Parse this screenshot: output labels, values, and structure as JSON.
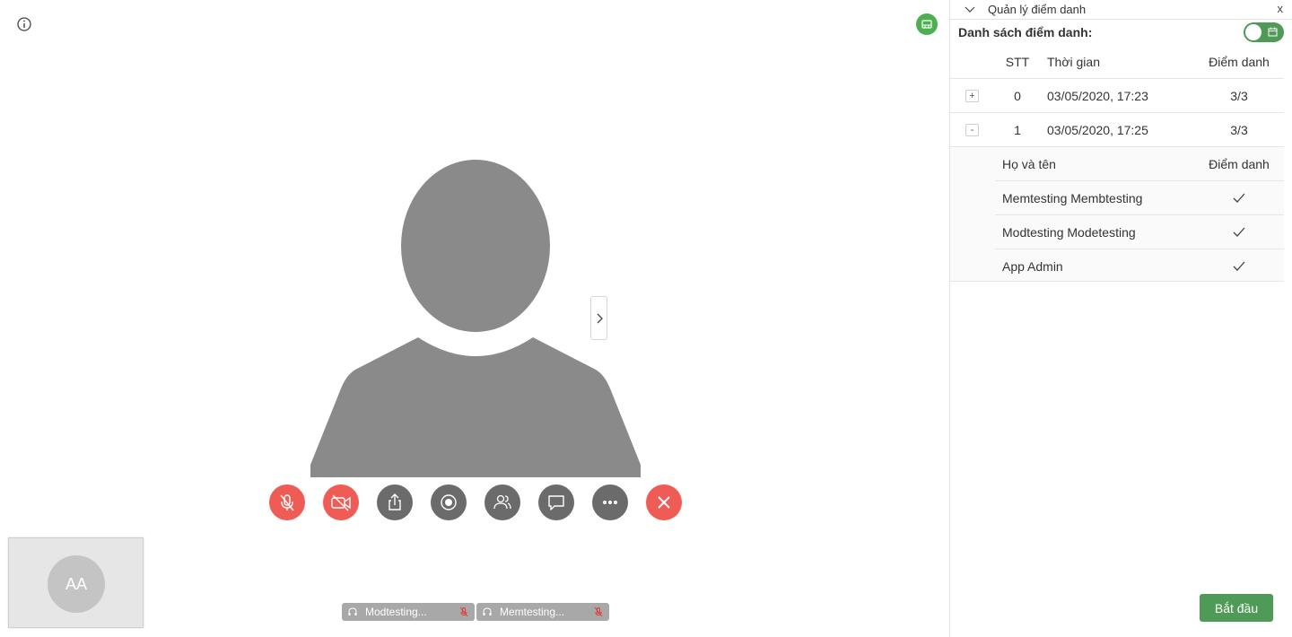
{
  "video": {
    "self_initials": "AA",
    "participants": [
      {
        "name": "Modtesting..."
      },
      {
        "name": "Memtesting..."
      }
    ],
    "colors": {
      "danger": "#ef5b55",
      "control": "#6b6b6b",
      "accent": "#4e9a56"
    }
  },
  "panel": {
    "title": "Quản lý điểm danh",
    "close_label": "x",
    "list_title": "Danh sách điểm danh:",
    "headers": {
      "stt": "STT",
      "time": "Thời gian",
      "score": "Điểm danh"
    },
    "sessions": [
      {
        "expand": "+",
        "stt": "0",
        "time": "03/05/2020, 17:23",
        "score": "3/3"
      },
      {
        "expand": "-",
        "stt": "1",
        "time": "03/05/2020, 17:25",
        "score": "3/3"
      }
    ],
    "sub_headers": {
      "name": "Họ và tên",
      "mark": "Điểm danh"
    },
    "attendees": [
      {
        "name": "Memtesting Membtesting"
      },
      {
        "name": "Modtesting Modetesting"
      },
      {
        "name": "App Admin"
      }
    ],
    "start_label": "Bắt đầu"
  }
}
